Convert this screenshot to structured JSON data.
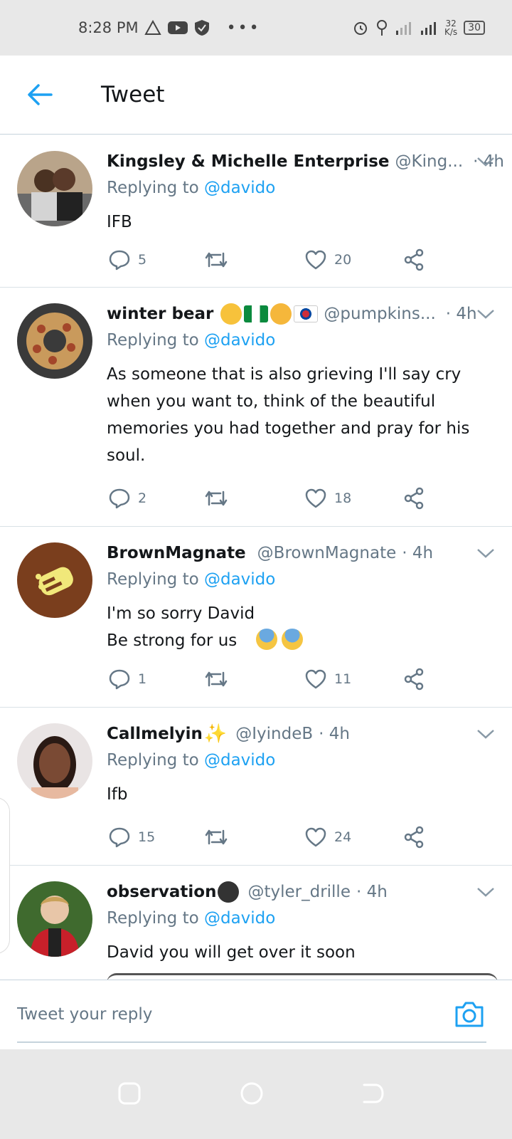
{
  "status_bar": {
    "time": "8:28 PM",
    "speed_value": "32",
    "speed_unit": "K/s",
    "battery": "30"
  },
  "header": {
    "title": "Tweet"
  },
  "tweets": [
    {
      "name": "Kingsley & Michelle Enterprise",
      "handle": "@King...",
      "time": "· 4h",
      "replying_prefix": "Replying to ",
      "replying_to": "@davido",
      "text": "IFB",
      "replies": "5",
      "retweets": "",
      "likes": "20"
    },
    {
      "name": "winter bear",
      "handle": "@pumpkins...",
      "time": "· 4h",
      "replying_prefix": "Replying to ",
      "replying_to": "@davido",
      "text": "As someone that is also grieving I'll say cry when you want to, think of the beautiful memories you had together and pray for his soul.",
      "replies": "2",
      "retweets": "",
      "likes": "18"
    },
    {
      "name": "BrownMagnate",
      "handle": "@BrownMagnate",
      "time": "· 4h",
      "replying_prefix": "Replying to ",
      "replying_to": "@davido",
      "text": "I'm so sorry David\nBe strong for us",
      "replies": "1",
      "retweets": "",
      "likes": "11"
    },
    {
      "name": "Callmelyin",
      "handle": "@IyindeB",
      "time": "· 4h",
      "replying_prefix": "Replying to ",
      "replying_to": "@davido",
      "text": "Ifb",
      "replies": "15",
      "retweets": "",
      "likes": "24"
    },
    {
      "name": "observation",
      "handle": "@tyler_drille",
      "time": "· 4h",
      "replying_prefix": "Replying to ",
      "replying_to": "@davido",
      "text": "David you will get over it soon"
    }
  ],
  "reply_box": {
    "placeholder": "Tweet your reply"
  },
  "colors": {
    "accent": "#1da1f2",
    "secondary_text": "#657786",
    "divider": "#d9e1e6"
  }
}
